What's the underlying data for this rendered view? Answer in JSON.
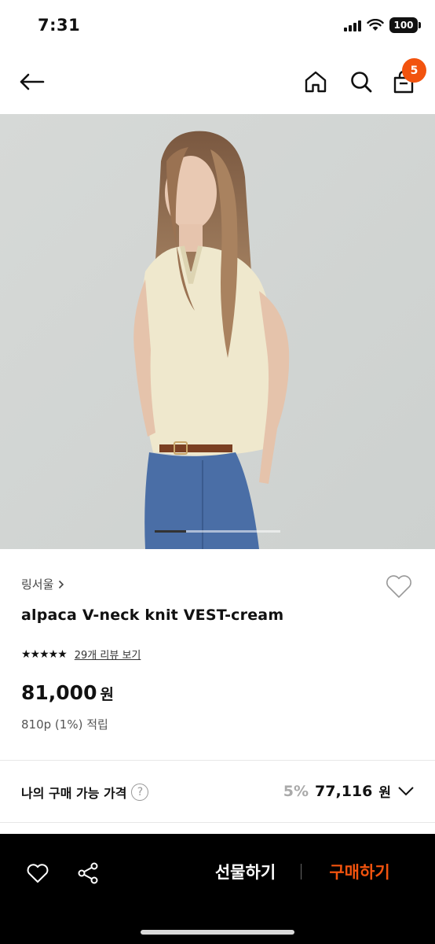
{
  "status_bar": {
    "time": "7:31",
    "battery": "100"
  },
  "nav": {
    "cart_count": "5"
  },
  "gallery": {
    "progress": 0.25
  },
  "product": {
    "brand": "링서울",
    "name": "alpaca V-neck knit VEST-cream",
    "stars": "★★★★★",
    "rating": 5,
    "review_link": "29개 리뷰 보기",
    "price": "81,000",
    "currency": "원",
    "points": "810p (1%) 적립"
  },
  "my_price": {
    "label": "나의 구매 가능 가격",
    "discount": "5%",
    "price": "77,116",
    "currency": "원"
  },
  "bottom_bar": {
    "gift_label": "선물하기",
    "buy_label": "구매하기"
  },
  "colors": {
    "accent": "#f2530e",
    "bar": "#000000"
  }
}
